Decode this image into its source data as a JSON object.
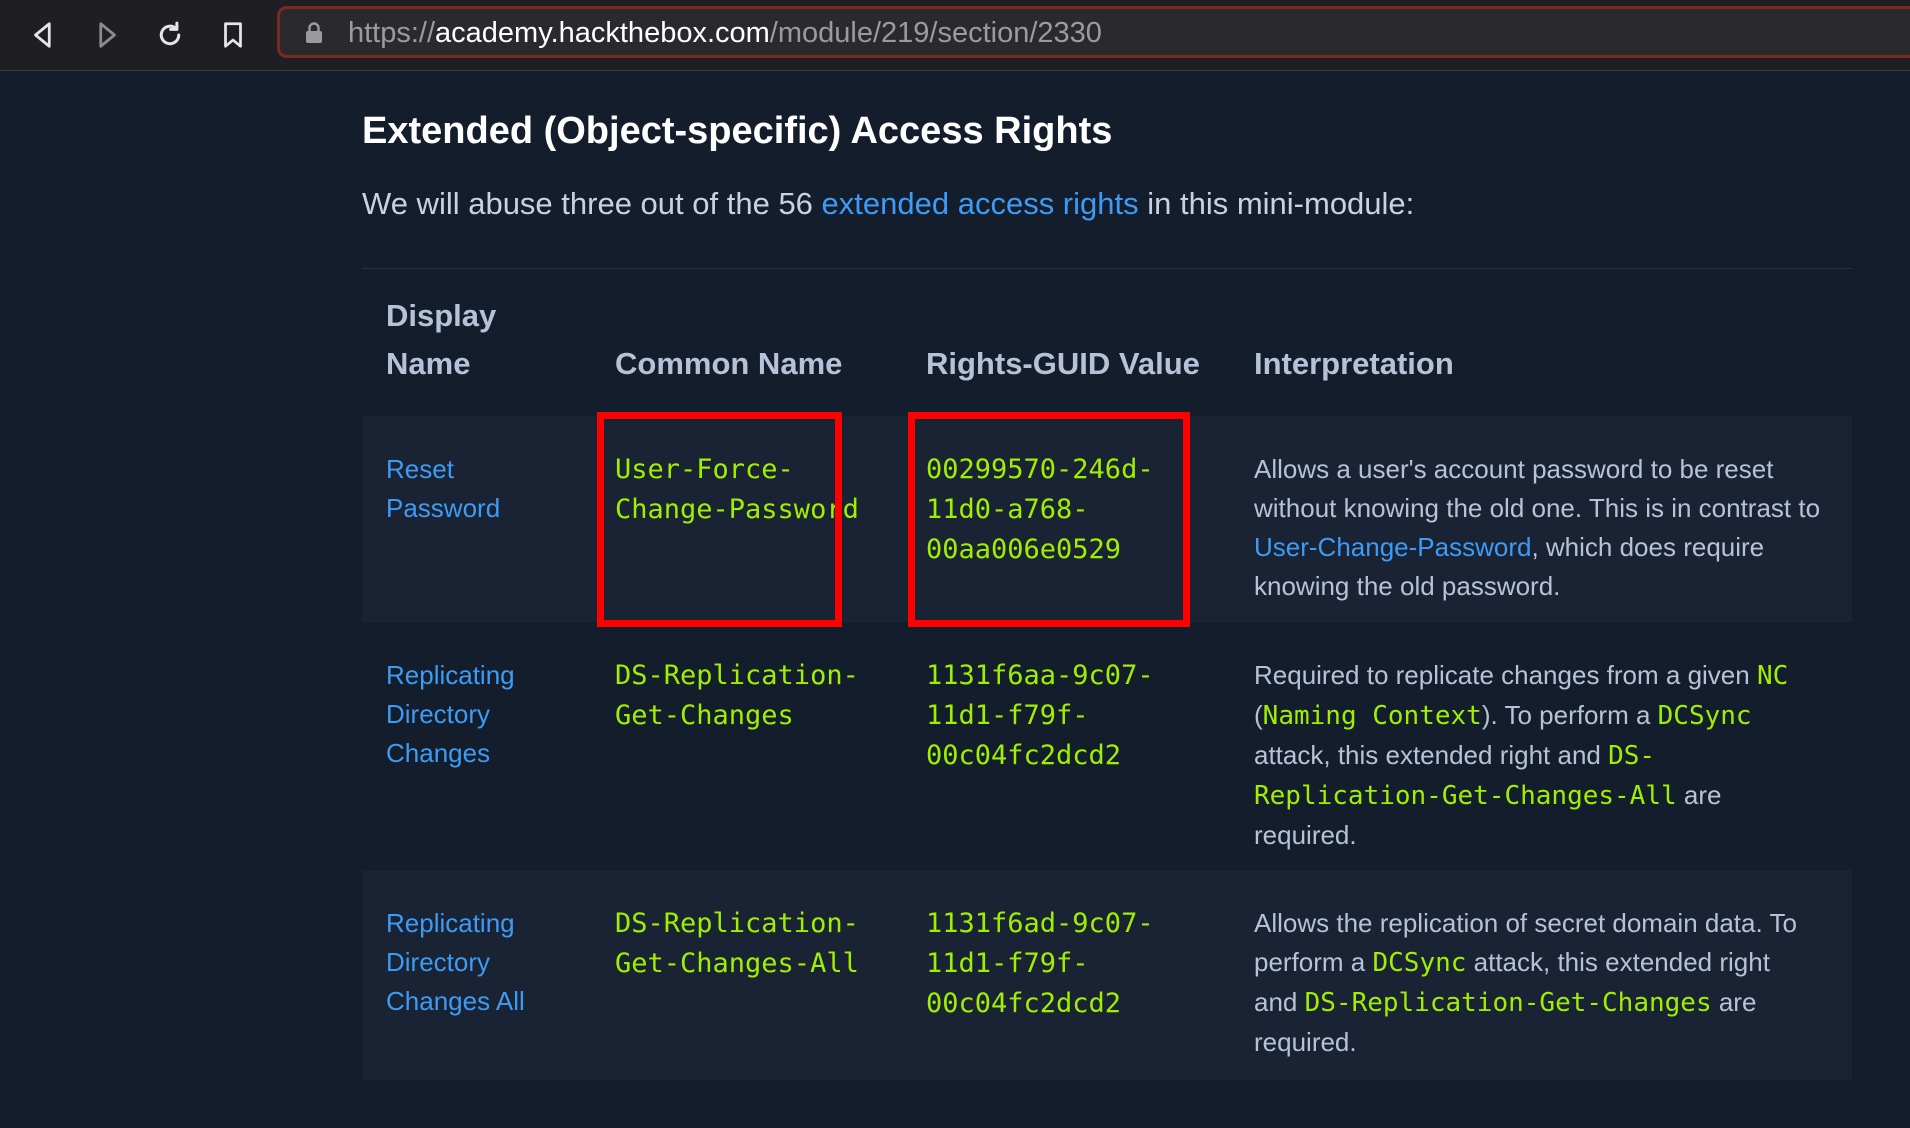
{
  "browser": {
    "url_scheme": "https://",
    "url_host": "academy.hackthebox.com",
    "url_path": "/module/219/section/2330",
    "icons": [
      "back-icon",
      "forward-icon",
      "reload-icon",
      "bookmark-icon",
      "lock-icon"
    ]
  },
  "page": {
    "title": "Extended (Object-specific) Access Rights",
    "intro_before": "We will abuse three out of the 56 ",
    "intro_link": "extended access rights",
    "intro_after": " in this mini-module:"
  },
  "table": {
    "headers": {
      "display_1": "Display",
      "display_2": "Name",
      "common": "Common Name",
      "guid": "Rights-GUID Value",
      "interp": "Interpretation"
    },
    "rows": [
      {
        "display": [
          "Reset",
          "Password"
        ],
        "common": [
          "User-Force-",
          "Change-Password"
        ],
        "guid": [
          "00299570-246d-",
          "11d0-a768-",
          "00aa006e0529"
        ],
        "interp": {
          "l1": "Allows a user's account password to be reset",
          "l2": "without knowing the old one. This is in contrast to",
          "l3_link": "User-Change-Password",
          "l3_rest": ", which does require",
          "l4": "knowing the old password."
        }
      },
      {
        "display": [
          "Replicating",
          "Directory",
          "Changes"
        ],
        "common": [
          "DS-Replication-",
          "Get-Changes"
        ],
        "guid": [
          "1131f6aa-9c07-",
          "11d1-f79f-",
          "00c04fc2dcd2"
        ],
        "interp": {
          "l1_text": "Required to replicate changes from a given ",
          "l1_code": "NC",
          "l2_open": "(",
          "l2_code1": "Naming Context",
          "l2_text": "). To perform a ",
          "l2_code2": "DCSync",
          "l3_text": "attack, this extended right and ",
          "l3_code": "DS-",
          "l4_code": "Replication-Get-Changes-All",
          "l4_text": " are",
          "l5": "required."
        }
      },
      {
        "display": [
          "Replicating",
          "Directory",
          "Changes All"
        ],
        "common": [
          "DS-Replication-",
          "Get-Changes-All"
        ],
        "guid": [
          "1131f6ad-9c07-",
          "11d1-f79f-",
          "00c04fc2dcd2"
        ],
        "interp": {
          "l1": "Allows the replication of secret domain data. To",
          "l2_text": "perform a ",
          "l2_code": "DCSync",
          "l2_rest": " attack, this extended right",
          "l3_text": "and ",
          "l3_code": "DS-Replication-Get-Changes",
          "l3_rest": " are",
          "l4": "required."
        }
      }
    ]
  },
  "colors": {
    "background": "#141d2b",
    "row_shade": "#1a2333",
    "link": "#3d9bf5",
    "code": "#9fef00",
    "highlight": "#ff0000"
  }
}
